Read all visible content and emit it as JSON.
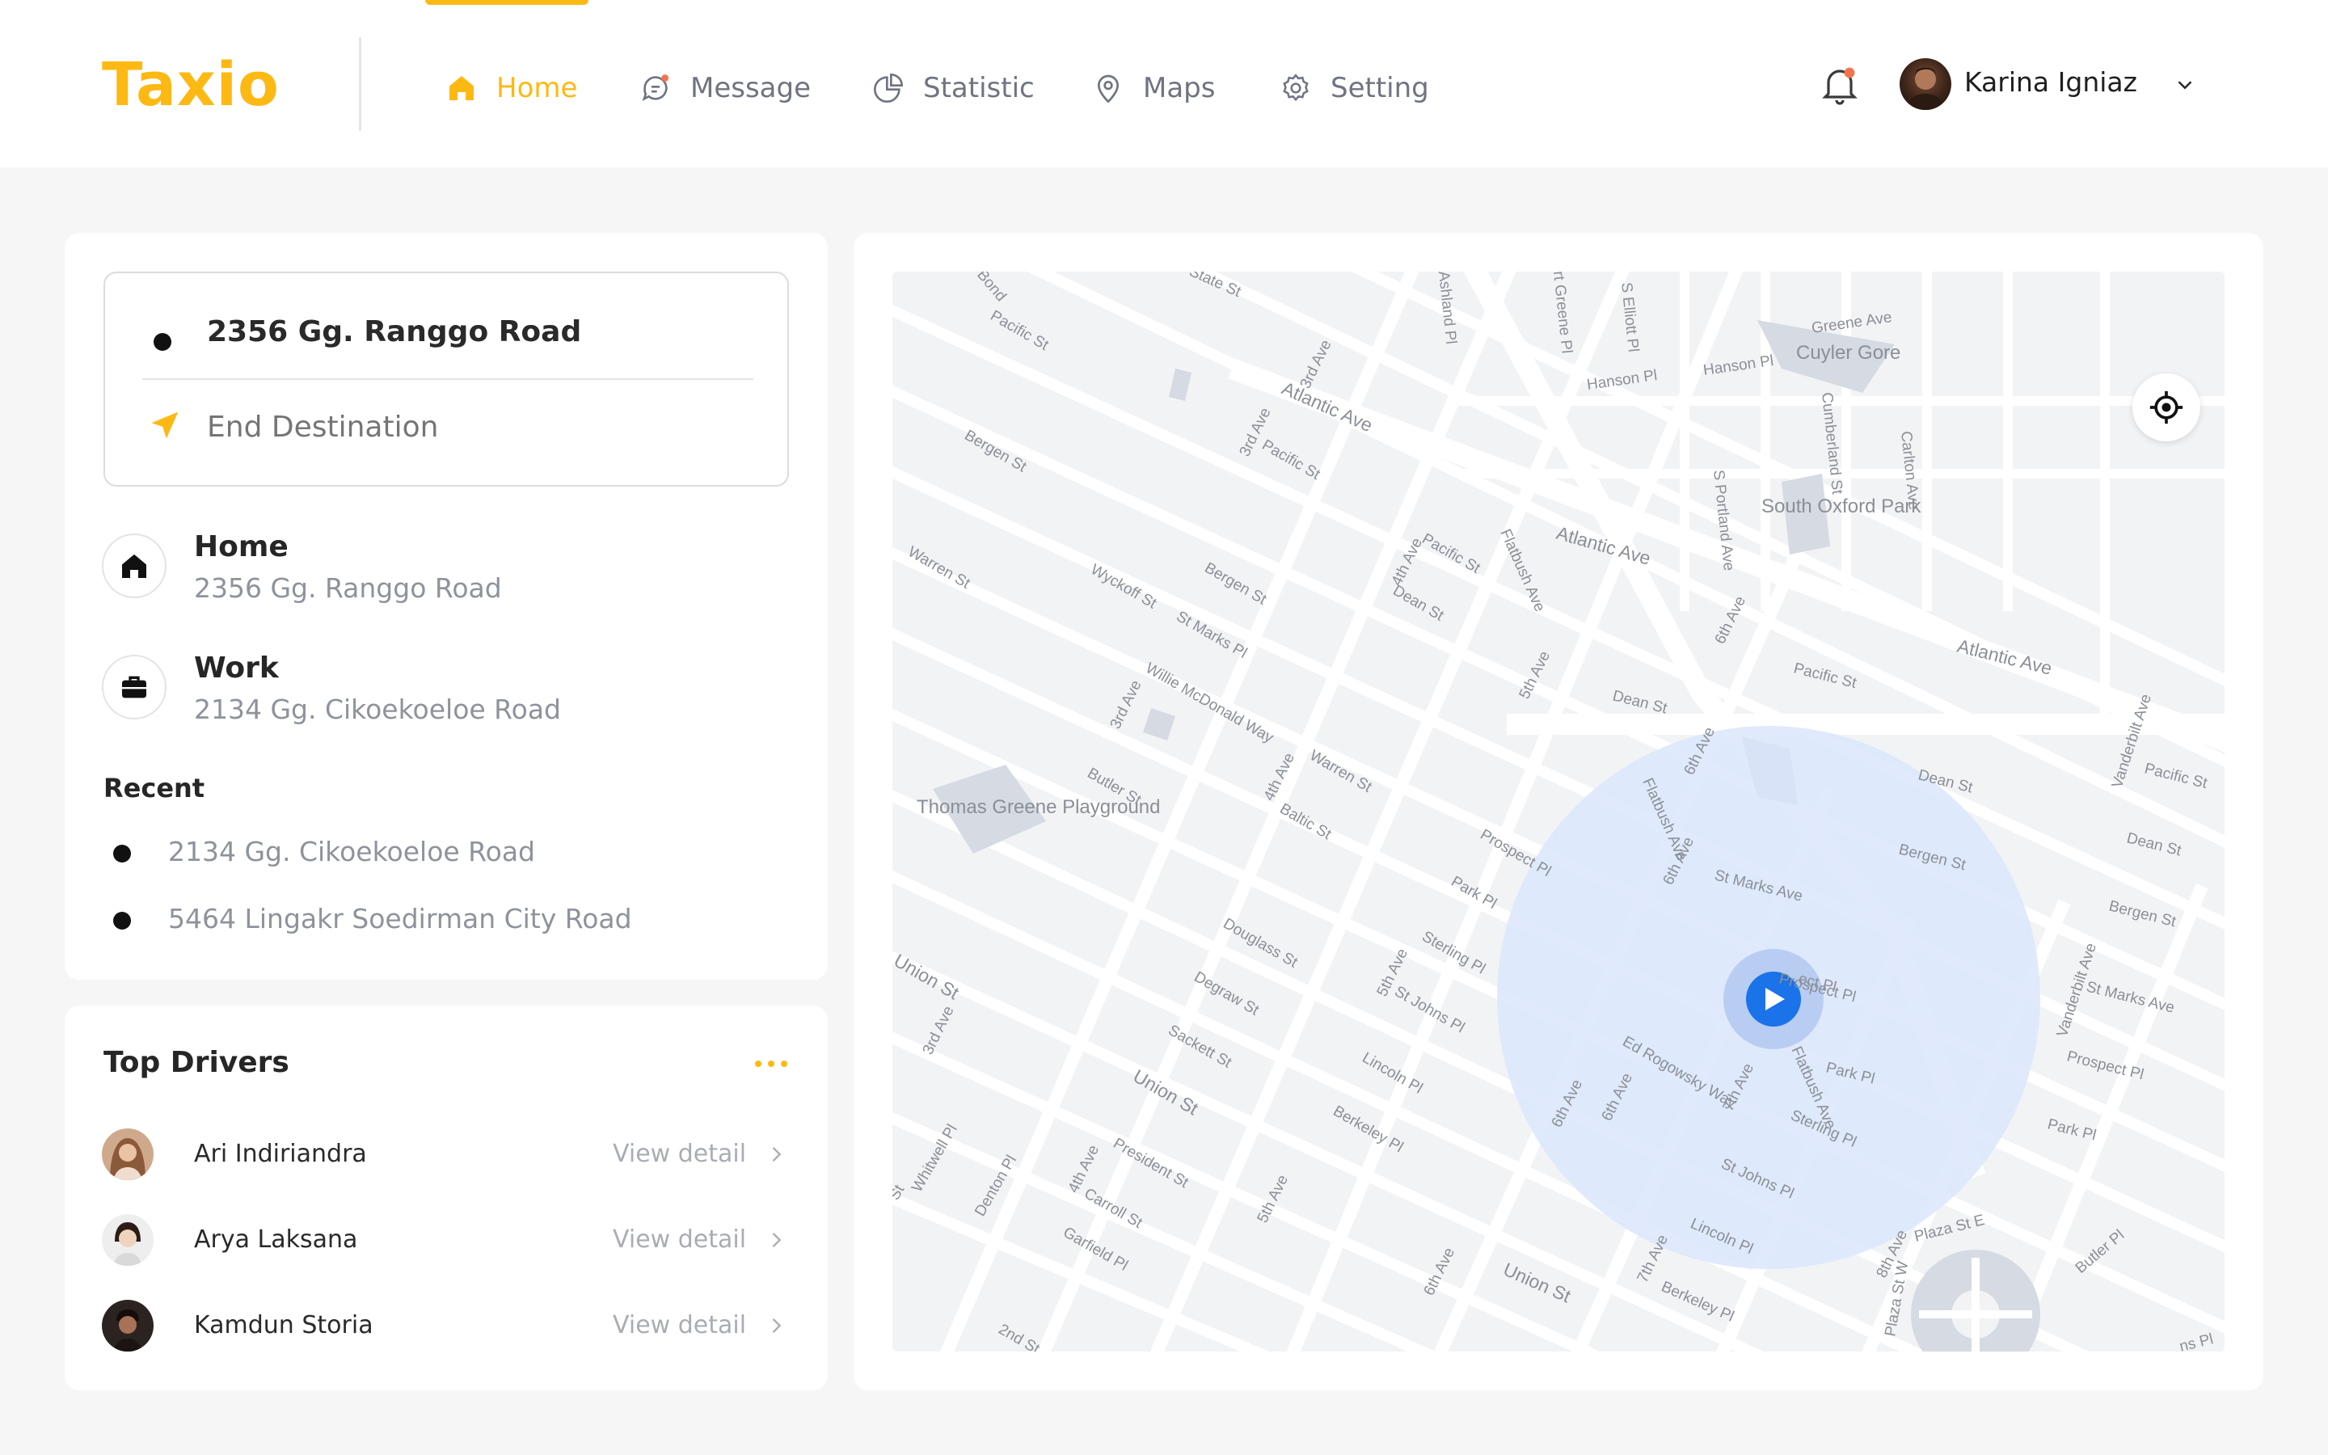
{
  "app": {
    "logo": "Taxio"
  },
  "nav": [
    {
      "label": "Home",
      "icon": "home-icon",
      "active": true
    },
    {
      "label": "Message",
      "icon": "message-icon",
      "active": false
    },
    {
      "label": "Statistic",
      "icon": "statistic-icon",
      "active": false
    },
    {
      "label": "Maps",
      "icon": "map-pin-icon",
      "active": false
    },
    {
      "label": "Setting",
      "icon": "gear-icon",
      "active": false
    }
  ],
  "user": {
    "name": "Karina Igniaz"
  },
  "route": {
    "start": "2356 Gg. Ranggo Road",
    "end_placeholder": "End Destination"
  },
  "saved_places": [
    {
      "title": "Home",
      "address": "2356 Gg. Ranggo Road",
      "icon": "home-icon"
    },
    {
      "title": "Work",
      "address": "2134 Gg. Cikoekoeloe Road",
      "icon": "briefcase-icon"
    }
  ],
  "recent": {
    "label": "Recent",
    "items": [
      "2134 Gg. Cikoekoeloe Road",
      "5464 Lingakr Soedirman City Road"
    ]
  },
  "drivers": {
    "title": "Top Drivers",
    "view_label": "View detail",
    "items": [
      {
        "name": "Ari Indiriandra"
      },
      {
        "name": "Arya Laksana"
      },
      {
        "name": "Kamdun Storia"
      }
    ]
  },
  "map": {
    "labels": {
      "cuyler_gore": "Cuyler Gore",
      "south_oxford_park": "South Oxford Park",
      "thomas_greene": "Thomas Greene Playground",
      "atlantic_1": "Atlantic Ave",
      "atlantic_2": "Atlantic Ave",
      "atlantic_3": "Atlantic Ave",
      "flatbush_1": "Flatbush Ave",
      "flatbush_2": "Flatbush Ave",
      "flatbush_3": "Flatbush Ave",
      "third_ave_1": "3rd Ave",
      "third_ave_2": "3rd Ave",
      "third_ave_3": "3rd Ave",
      "third_ave_4": "3rd Ave",
      "fourth_ave_1": "4th Ave",
      "fourth_ave_2": "4th Ave",
      "fourth_ave_3": "4th Ave",
      "fifth_ave_1": "5th Ave",
      "fifth_ave_2": "5th Ave",
      "fifth_ave_3": "5th Ave",
      "sixth_ave_1": "6th Ave",
      "sixth_ave_2": "6th Ave",
      "sixth_ave_3": "6th Ave",
      "sixth_ave_4": "6th Ave",
      "sixth_ave_5": "6th Ave",
      "sixth_ave_6": "6th Ave",
      "seventh_ave_1": "7th Ave",
      "seventh_ave_2": "7th Ave",
      "eighth_ave": "8th Ave",
      "union_1": "Union St",
      "union_2": "Union St",
      "union_3": "Union St",
      "pacific_1": "Pacific St",
      "pacific_2": "Pacific St",
      "pacific_3": "Pacific St",
      "pacific_4": "Pacific St",
      "pacific_5": "Pacific St",
      "bergen_1": "Bergen St",
      "bergen_2": "Bergen St",
      "bergen_3": "Bergen St",
      "bergen_4": "Bergen St",
      "dean_1": "Dean St",
      "dean_2": "Dean St",
      "dean_3": "Dean St",
      "dean_4": "Dean St",
      "st_marks_1": "St Marks Pl",
      "st_marks_2": "St Marks Ave",
      "st_marks_3": "St Marks Ave",
      "prospect_1": "Prospect Pl",
      "prospect_2": "Prospect Pl",
      "prospect_3": "Prospect Pl",
      "park_1": "Park Pl",
      "park_2": "Park Pl",
      "park_3": "Park Pl",
      "sterling_1": "Sterling Pl",
      "sterling_2": "Sterling Pl",
      "st_johns_1": "St Johns Pl",
      "st_johns_2": "St Johns Pl",
      "lincoln_1": "Lincoln Pl",
      "lincoln_2": "Lincoln Pl",
      "berkeley_1": "Berkeley Pl",
      "berkeley_2": "Berkeley Pl",
      "butler_1": "Butler St",
      "butler_2": "Butler Pl",
      "baltic": "Baltic St",
      "warren_1": "Warren St",
      "warren_2": "Warren St",
      "douglass": "Douglass St",
      "degraw": "Degraw St",
      "sackett": "Sackett St",
      "president": "President St",
      "carroll": "Carroll St",
      "garfield": "Garfield Pl",
      "second_st": "2nd St",
      "wyckoff": "Wyckoff St",
      "willie": "Willie McDonald Way",
      "ed_rogowsky": "Ed Rogowsky Way",
      "vanderbilt_1": "Vanderbilt Ave",
      "vanderbilt_2": "Vanderbilt Ave",
      "hanson_1": "Hanson Pl",
      "hanson_2": "Hanson Pl",
      "greene": "Greene Ave",
      "cumberland": "Cumberland St",
      "carlton": "Carlton Ave",
      "s_portland": "S Portland Ave",
      "s_elliott": "S Elliott Pl",
      "ft_greene": "rt Greene Pl",
      "ashland": "Ashland Pl",
      "state": "State St",
      "bond": "Bond",
      "plaza_st_e": "Plaza St E",
      "plaza_st_w": "Plaza St W",
      "whitwell": "Whitwell Pl",
      "denton": "Denton Pl",
      "st_frag": "St",
      "ns_pl": "ns Pl",
      "ect_pl": "ect Pl"
    }
  },
  "colors": {
    "accent": "#fdb913",
    "primary_blue": "#1a73e8",
    "radius_fill": "#dbe6fb"
  }
}
